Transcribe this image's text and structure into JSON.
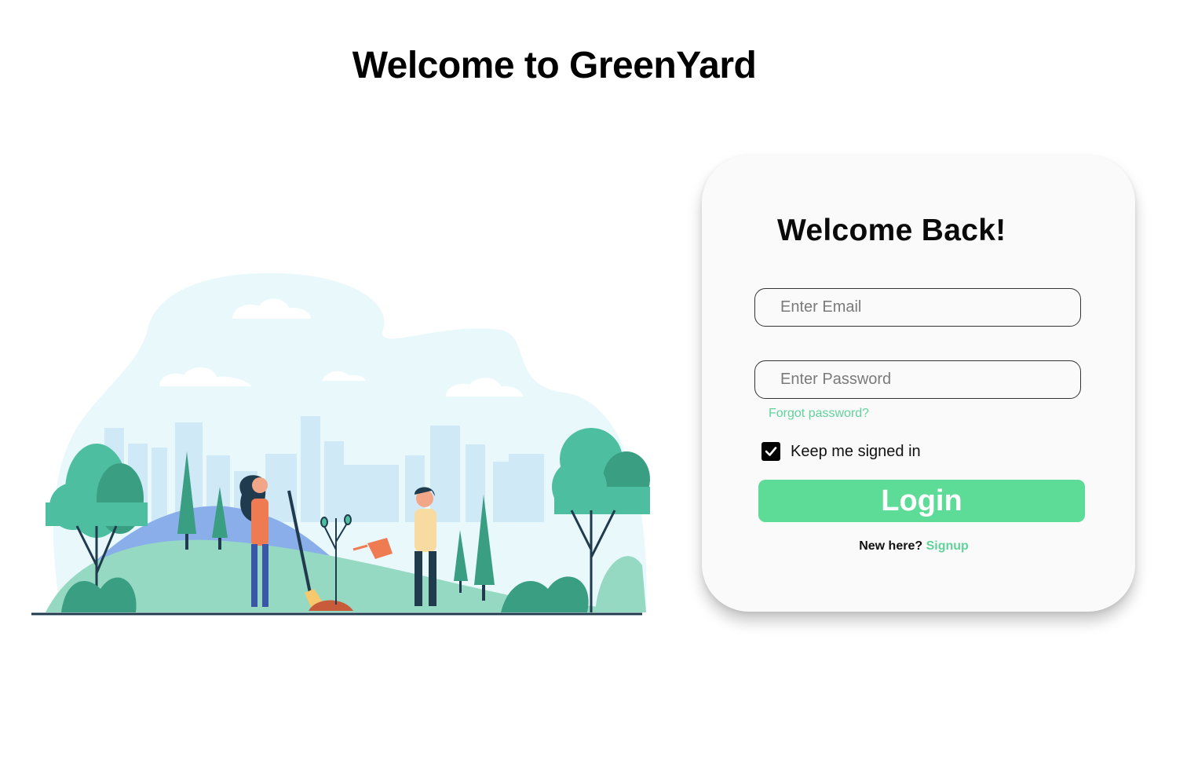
{
  "page": {
    "title": "Welcome to GreenYard"
  },
  "login": {
    "heading": "Welcome Back!",
    "email_placeholder": "Enter Email",
    "password_placeholder": "Enter Password",
    "forgot_label": "Forgot password?",
    "remember_label": "Keep me signed in",
    "remember_checked": true,
    "login_label": "Login",
    "signup_prompt": "New here?",
    "signup_label": "Signup"
  },
  "illustration": {
    "icon": "gardening-illustration"
  },
  "colors": {
    "accent_green": "#5ddc97",
    "link_green": "#5fd39a",
    "card_background": "#fbfafa",
    "tree_green": "#4dbfa0",
    "sky_blue": "#e9f8fb"
  }
}
